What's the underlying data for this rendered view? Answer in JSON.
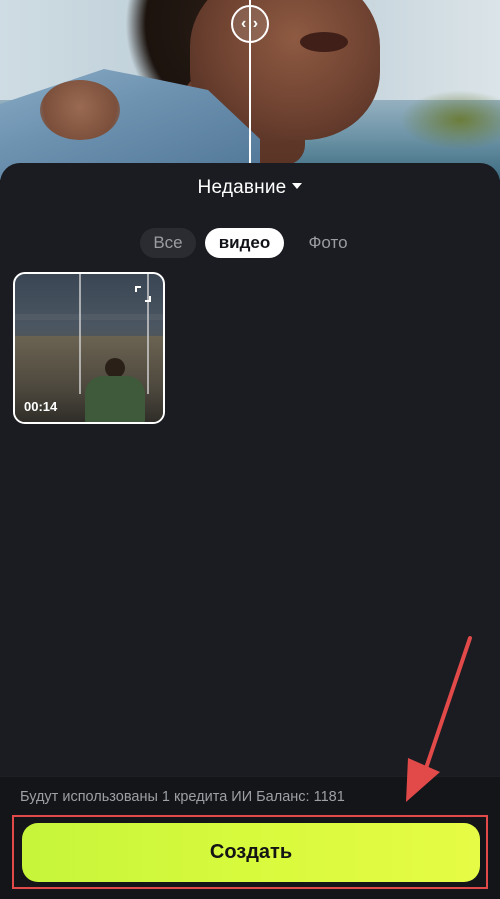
{
  "preview": {
    "compare_handle_icon": "compare-arrows-icon",
    "compare_handle_label": "‹ ›"
  },
  "sheet": {
    "album_title": "Недавние",
    "tabs": [
      {
        "label": "Все",
        "selected": false
      },
      {
        "label": "видео",
        "selected": true
      },
      {
        "label": "Фото",
        "selected": false
      }
    ],
    "media": [
      {
        "type": "video",
        "duration": "00:14",
        "selected": true,
        "expand_icon": "expand-icon"
      }
    ]
  },
  "footer": {
    "credits_text": "Будут использованы 1 кредита ИИ Баланс: 1181",
    "create_label": "Создать",
    "create_color": "#d4f83c",
    "highlight_color": "#e24a4a"
  }
}
